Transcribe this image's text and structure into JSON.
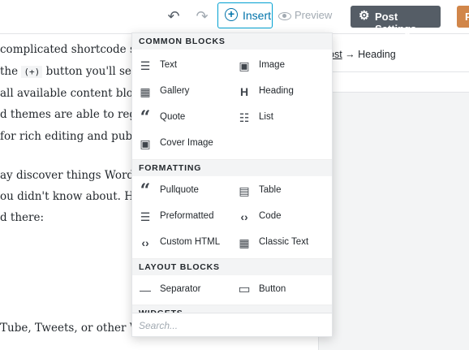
{
  "toolbar": {
    "insert_label": "Insert",
    "preview_label": "Preview",
    "post_settings_label": "Post Settings",
    "publish_label": "P"
  },
  "editor": {
    "lines": [
      " complicated shortcode s",
      "the",
      "(+)",
      "button you'll see",
      " all available content blo",
      "d themes are able to regi",
      " for rich editing and pub",
      "ay discover things Word",
      "ou didn't know about. He",
      "d there:",
      "Tube, Tweets, or other W"
    ]
  },
  "sidebar": {
    "breadcrumb_post": "ost",
    "breadcrumb_rest": " → Heading"
  },
  "inserter": {
    "sections": {
      "common": "COMMON BLOCKS",
      "formatting": "FORMATTING",
      "layout": "LAYOUT BLOCKS",
      "widgets": "WIDGETS"
    },
    "common_blocks": [
      {
        "label": "Text",
        "icon": "text-icon"
      },
      {
        "label": "Image",
        "icon": "image-icon"
      },
      {
        "label": "Gallery",
        "icon": "gallery-icon"
      },
      {
        "label": "Heading",
        "icon": "heading-icon"
      },
      {
        "label": "Quote",
        "icon": "quote-icon"
      },
      {
        "label": "List",
        "icon": "list-icon"
      },
      {
        "label": "Cover Image",
        "icon": "cover-image-icon"
      }
    ],
    "formatting": [
      {
        "label": "Pullquote",
        "icon": "pullquote-icon"
      },
      {
        "label": "Table",
        "icon": "table-icon"
      },
      {
        "label": "Preformatted",
        "icon": "preformatted-icon"
      },
      {
        "label": "Code",
        "icon": "code-icon"
      },
      {
        "label": "Custom HTML",
        "icon": "custom-html-icon"
      },
      {
        "label": "Classic Text",
        "icon": "classic-text-icon"
      }
    ],
    "layout_blocks": [
      {
        "label": "Separator",
        "icon": "separator-icon"
      },
      {
        "label": "Button",
        "icon": "button-icon"
      }
    ],
    "search_placeholder": "Search..."
  },
  "colors": {
    "accent": "#0073aa",
    "accent_border": "#00a0d2",
    "dark_button": "#555d66",
    "publish": "#d1864a",
    "panel_bg": "#f3f4f5"
  }
}
